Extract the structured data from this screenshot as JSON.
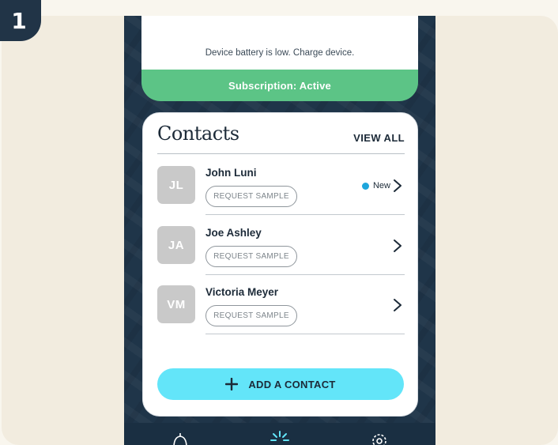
{
  "step": {
    "number": "1"
  },
  "notice": {
    "battery_text": "Device battery is low. Charge device.",
    "subscription_text": "Subscription: Active"
  },
  "contacts": {
    "title": "Contacts",
    "view_all_label": "VIEW ALL",
    "items": [
      {
        "initials": "JL",
        "name": "John Luni",
        "action_label": "REQUEST SAMPLE",
        "badge": "New"
      },
      {
        "initials": "JA",
        "name": "Joe Ashley",
        "action_label": "REQUEST SAMPLE"
      },
      {
        "initials": "VM",
        "name": "Victoria Meyer",
        "action_label": "REQUEST SAMPLE"
      }
    ],
    "add_label": "ADD A CONTACT"
  },
  "nav": {
    "icons": [
      "bell-icon",
      "sun-icon",
      "gear-icon"
    ]
  },
  "colors": {
    "page_bg": "#f2ecdf",
    "phone_bg": "#1f3549",
    "subscription_bg": "#5cc486",
    "add_button_bg": "#63e5f9",
    "new_dot": "#1ea6dc",
    "avatar_bg": "#c9c9c9"
  }
}
